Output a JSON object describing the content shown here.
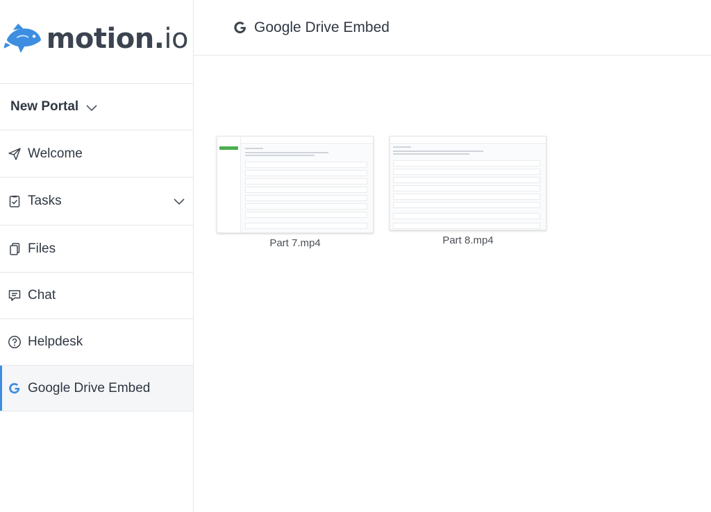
{
  "brand": {
    "name_main": "motion.",
    "name_tail": "io",
    "logo_color": "#3d8ee0"
  },
  "portal": {
    "label": "New Portal",
    "icon": "chevron-down-icon"
  },
  "nav": {
    "welcome": {
      "label": "Welcome",
      "icon": "paper-plane-icon"
    },
    "tasks": {
      "label": "Tasks",
      "icon": "task-list-icon"
    },
    "files": {
      "label": "Files",
      "icon": "files-icon"
    },
    "chat": {
      "label": "Chat",
      "icon": "chat-icon"
    },
    "helpdesk": {
      "label": "Helpdesk",
      "icon": "help-circle-icon"
    },
    "gdrive": {
      "label": "Google Drive Embed",
      "icon": "google-g-icon",
      "active": true
    }
  },
  "header": {
    "title": "Google Drive Embed",
    "icon": "google-g-icon"
  },
  "files": [
    {
      "name": "Part 7.mp4"
    },
    {
      "name": "Part 8.mp4"
    }
  ],
  "colors": {
    "accent": "#3d8ee0",
    "text": "#2f3742",
    "border": "#e3e6ea"
  }
}
